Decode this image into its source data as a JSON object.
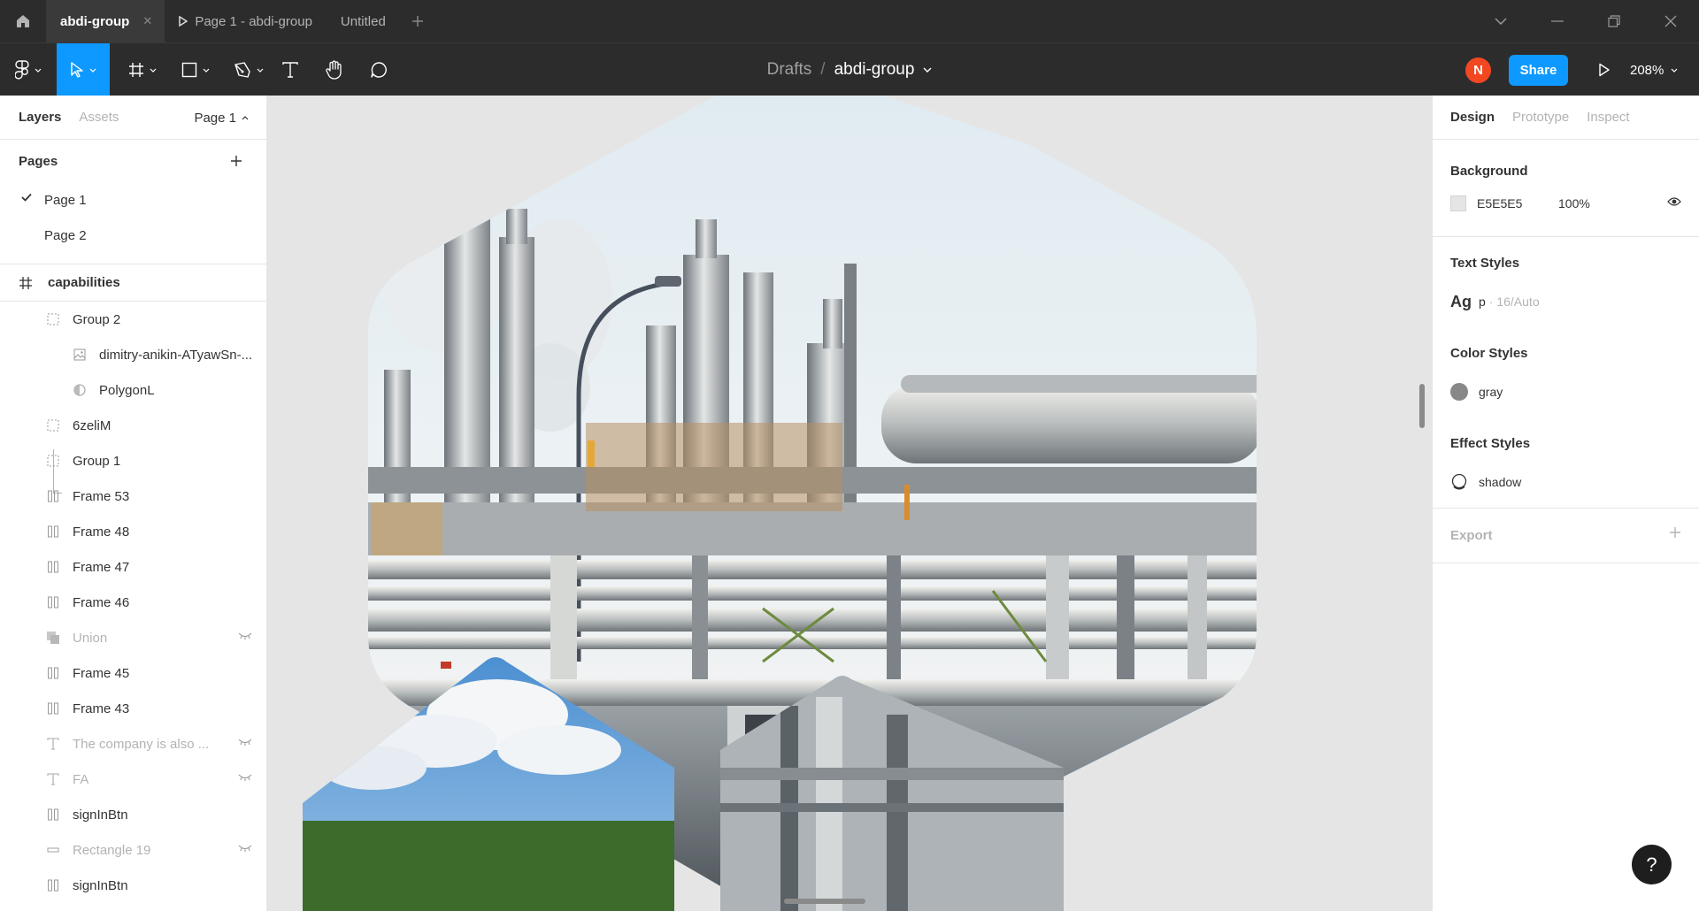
{
  "titlebar": {
    "tabs": [
      {
        "label": "abdi-group",
        "active": true
      },
      {
        "label": "Page 1 - abdi-group",
        "active": false
      },
      {
        "label": "Untitled",
        "active": false
      }
    ]
  },
  "toolbar": {
    "breadcrumb": {
      "parent": "Drafts",
      "separator": "/",
      "file": "abdi-group"
    },
    "avatar_initial": "N",
    "share_label": "Share",
    "zoom": "208%"
  },
  "left_panel": {
    "tabs": [
      "Layers",
      "Assets"
    ],
    "page_selector": "Page 1",
    "pages_title": "Pages",
    "pages": [
      {
        "label": "Page 1",
        "current": true
      },
      {
        "label": "Page 2",
        "current": false
      }
    ],
    "frame": "capabilities",
    "layers": [
      {
        "label": "Group 2",
        "icon": "group-icon",
        "child": false,
        "hidden": false
      },
      {
        "label": "dimitry-anikin-ATyawSn-...",
        "icon": "image-icon",
        "child": true,
        "hidden": false
      },
      {
        "label": "PolygonL",
        "icon": "mask-icon",
        "child": true,
        "hidden": false
      },
      {
        "label": "6zeliM",
        "icon": "group-icon",
        "child": false,
        "hidden": false
      },
      {
        "label": "Group 1",
        "icon": "group-icon",
        "child": false,
        "hidden": false
      },
      {
        "label": "Frame 53",
        "icon": "autolayout-icon",
        "child": false,
        "hidden": false
      },
      {
        "label": "Frame 48",
        "icon": "autolayout-icon",
        "child": false,
        "hidden": false
      },
      {
        "label": "Frame 47",
        "icon": "autolayout-icon",
        "child": false,
        "hidden": false
      },
      {
        "label": "Frame 46",
        "icon": "autolayout-icon",
        "child": false,
        "hidden": false
      },
      {
        "label": "Union",
        "icon": "union-icon",
        "child": false,
        "hidden": true
      },
      {
        "label": "Frame 45",
        "icon": "autolayout-icon",
        "child": false,
        "hidden": false
      },
      {
        "label": "Frame 43",
        "icon": "autolayout-icon",
        "child": false,
        "hidden": false
      },
      {
        "label": "The company is also ...",
        "icon": "text-icon",
        "child": false,
        "hidden": true
      },
      {
        "label": "FA",
        "icon": "text-icon",
        "child": false,
        "hidden": true
      },
      {
        "label": "signInBtn",
        "icon": "autolayout-icon",
        "child": false,
        "hidden": false
      },
      {
        "label": "Rectangle 19",
        "icon": "rectangle-icon",
        "child": false,
        "hidden": true
      },
      {
        "label": "signInBtn",
        "icon": "autolayout-icon",
        "child": false,
        "hidden": false
      }
    ]
  },
  "right_panel": {
    "tabs": [
      "Design",
      "Prototype",
      "Inspect"
    ],
    "background": {
      "title": "Background",
      "hex": "E5E5E5",
      "opacity": "100%"
    },
    "text_styles": {
      "title": "Text Styles",
      "sample": "Ag",
      "name": "p",
      "detail": "· 16/Auto"
    },
    "color_styles": {
      "title": "Color Styles",
      "name": "gray",
      "color": "#888888"
    },
    "effect_styles": {
      "title": "Effect Styles",
      "name": "shadow"
    },
    "export_title": "Export",
    "help": "?"
  },
  "colors": {
    "accent": "#0d99ff",
    "avatar": "#f24822",
    "toolbar": "#2c2c2c",
    "canvas": "#e5e5e5"
  }
}
